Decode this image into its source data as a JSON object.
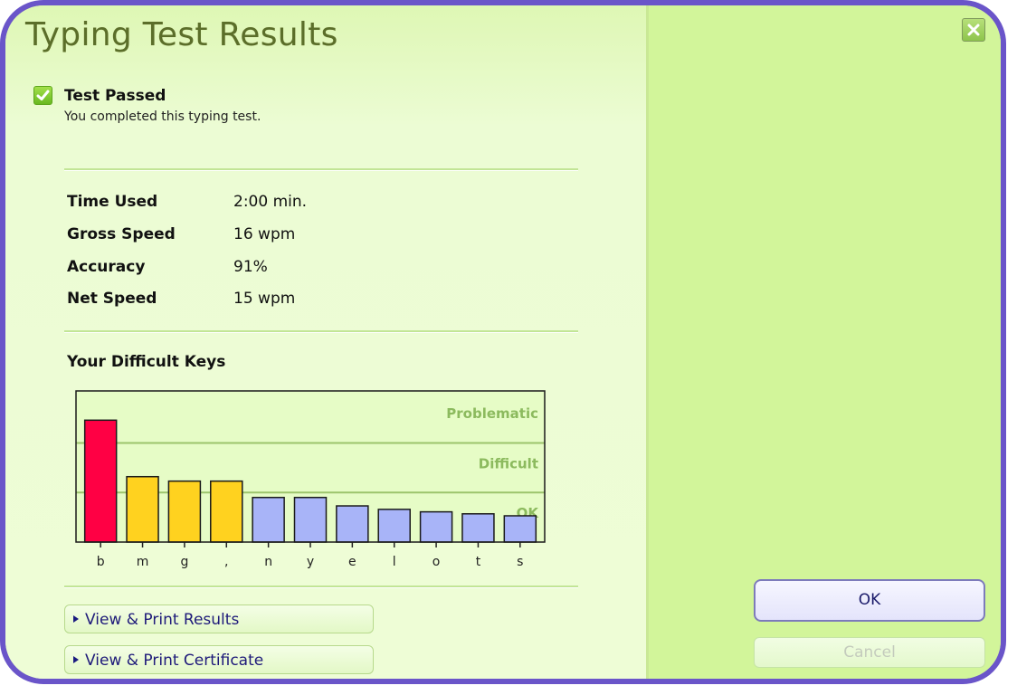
{
  "window": {
    "title": "Typing Test Results",
    "close_icon": "close-x-icon"
  },
  "status": {
    "icon": "checkbox-checked-icon",
    "heading": "Test Passed",
    "message": "You completed this typing test."
  },
  "stats": [
    {
      "label": "Time Used",
      "value": "2:00 min."
    },
    {
      "label": "Gross Speed",
      "value": "16 wpm"
    },
    {
      "label": "Accuracy",
      "value": "91%"
    },
    {
      "label": "Net Speed",
      "value": "15 wpm"
    }
  ],
  "difficult_keys": {
    "title": "Your Difficult Keys"
  },
  "links": [
    {
      "label": "View & Print Results",
      "icon": "play-triangle-icon"
    },
    {
      "label": "View & Print Certificate",
      "icon": "play-triangle-icon"
    }
  ],
  "buttons": {
    "ok": "OK",
    "cancel": "Cancel"
  },
  "colors": {
    "border": "#6a55c9",
    "title": "#5b6e2a",
    "problematic": "#ff0044",
    "difficult": "#ffd21f",
    "ok": "#a8b4f8",
    "zone_label": "#8cba5e",
    "gridline": "#9cc46c"
  },
  "chart_data": {
    "type": "bar",
    "title": "Your Difficult Keys",
    "xlabel": "",
    "ylabel": "",
    "categories": [
      "b",
      "m",
      "g",
      ",",
      "n",
      "y",
      "e",
      "l",
      "o",
      "t",
      "s"
    ],
    "values": [
      2.46,
      1.32,
      1.23,
      1.23,
      0.9,
      0.9,
      0.73,
      0.66,
      0.61,
      0.57,
      0.53
    ],
    "levels": [
      "problematic",
      "difficult",
      "difficult",
      "difficult",
      "ok",
      "ok",
      "ok",
      "ok",
      "ok",
      "ok",
      "ok"
    ],
    "zones": [
      {
        "name": "OK",
        "from": 0,
        "to": 1
      },
      {
        "name": "Difficult",
        "from": 1,
        "to": 2
      },
      {
        "name": "Problematic",
        "from": 2,
        "to": 3.05
      }
    ],
    "ylim": [
      0,
      3.05
    ],
    "grid": true,
    "legend": "none"
  }
}
